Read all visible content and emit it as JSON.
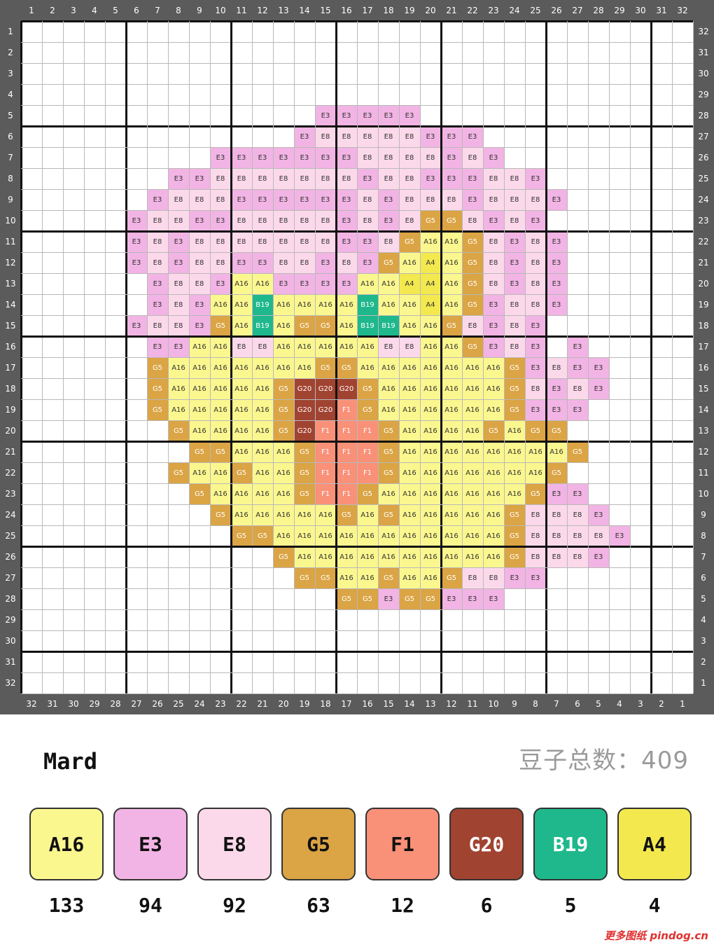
{
  "brand": "Mard",
  "total_label": "豆子总数：409",
  "site_label": "更多图纸 pindog.cn",
  "col_labels_top": [
    "1",
    "2",
    "3",
    "4",
    "5",
    "6",
    "7",
    "8",
    "9",
    "10",
    "11",
    "12",
    "13",
    "14",
    "15",
    "16",
    "17",
    "18",
    "19",
    "20",
    "21",
    "22",
    "23",
    "24",
    "25",
    "26",
    "27",
    "28",
    "29",
    "30",
    "31",
    "32"
  ],
  "col_labels_bottom": [
    "32",
    "31",
    "30",
    "29",
    "28",
    "27",
    "26",
    "25",
    "24",
    "23",
    "22",
    "21",
    "20",
    "19",
    "18",
    "17",
    "16",
    "15",
    "14",
    "13",
    "12",
    "11",
    "10",
    "9",
    "8",
    "7",
    "6",
    "5",
    "4",
    "3",
    "2",
    "1"
  ],
  "row_labels_left": [
    "1",
    "2",
    "3",
    "4",
    "5",
    "6",
    "7",
    "8",
    "9",
    "10",
    "11",
    "12",
    "13",
    "14",
    "15",
    "16",
    "17",
    "18",
    "19",
    "20",
    "21",
    "22",
    "23",
    "24",
    "25",
    "26",
    "27",
    "28",
    "29",
    "30",
    "31",
    "32"
  ],
  "row_labels_right": [
    "32",
    "31",
    "30",
    "29",
    "28",
    "27",
    "26",
    "25",
    "24",
    "23",
    "22",
    "21",
    "20",
    "19",
    "18",
    "17",
    "16",
    "15",
    "14",
    "13",
    "12",
    "11",
    "10",
    "9",
    "8",
    "7",
    "6",
    "5",
    "4",
    "3",
    "2",
    "1"
  ],
  "colors": {
    "A16": {
      "hex": "#fbf78f",
      "text": "#333333"
    },
    "E3": {
      "hex": "#f2b4e4",
      "text": "#333333"
    },
    "E8": {
      "hex": "#fcd9ea",
      "text": "#333333"
    },
    "G5": {
      "hex": "#dba444",
      "text": "#ffffff"
    },
    "F1": {
      "hex": "#f99078",
      "text": "#ffffff"
    },
    "G20": {
      "hex": "#a14331",
      "text": "#ffffff"
    },
    "B19": {
      "hex": "#1fb88c",
      "text": "#ffffff"
    },
    "A4": {
      "hex": "#f3e94e",
      "text": "#333333"
    }
  },
  "pattern": [
    {
      "row": 5,
      "start": 15,
      "cells": [
        "E3",
        "E3",
        "E3",
        "E3",
        "E3"
      ]
    },
    {
      "row": 6,
      "start": 14,
      "cells": [
        "E3",
        "E8",
        "E8",
        "E8",
        "E8",
        "E8",
        "E3",
        "E3",
        "E3"
      ]
    },
    {
      "row": 7,
      "start": 10,
      "cells": [
        "E3",
        "E3",
        "E3",
        "E3",
        "E3",
        "E3",
        "E3",
        "E8",
        "E8",
        "E8",
        "E8",
        "E3",
        "E8",
        "E3"
      ]
    },
    {
      "row": 8,
      "start": 8,
      "cells": [
        "E3",
        "E3",
        "E8",
        "E8",
        "E8",
        "E8",
        "E8",
        "E8",
        "E8",
        "E3",
        "E8",
        "E8",
        "E3",
        "E3",
        "E3",
        "E8",
        "E8",
        "E3"
      ]
    },
    {
      "row": 9,
      "start": 7,
      "cells": [
        "E3",
        "E8",
        "E8",
        "E8",
        "E3",
        "E3",
        "E3",
        "E3",
        "E3",
        "E3",
        "E8",
        "E3",
        "E8",
        "E8",
        "E8",
        "E3",
        "E8",
        "E8",
        "E8",
        "E3"
      ]
    },
    {
      "row": 10,
      "start": 6,
      "cells": [
        "E3",
        "E8",
        "E8",
        "E3",
        "E3",
        "E8",
        "E8",
        "E8",
        "E8",
        "E8",
        "E3",
        "E8",
        "E3",
        "E8",
        "G5",
        "G5",
        "E8",
        "E3",
        "E8",
        "E3"
      ]
    },
    {
      "row": 11,
      "start": 6,
      "cells": [
        "E3",
        "E8",
        "E3",
        "E8",
        "E8",
        "E8",
        "E8",
        "E8",
        "E8",
        "E8",
        "E3",
        "E3",
        "E8",
        "G5",
        "A16",
        "A16",
        "G5",
        "E8",
        "E3",
        "E8",
        "E3"
      ]
    },
    {
      "row": 12,
      "start": 6,
      "cells": [
        "E3",
        "E8",
        "E3",
        "E8",
        "E8",
        "E3",
        "E3",
        "E8",
        "E8",
        "E3",
        "E8",
        "E3",
        "G5",
        "A16",
        "A4",
        "A16",
        "G5",
        "E8",
        "E3",
        "E8",
        "E3"
      ]
    },
    {
      "row": 13,
      "start": 7,
      "cells": [
        "E3",
        "E8",
        "E8",
        "E3",
        "A16",
        "A16",
        "E3",
        "E3",
        "E3",
        "E3",
        "A16",
        "A16",
        "A4",
        "A4",
        "A16",
        "G5",
        "E8",
        "E3",
        "E8",
        "E3"
      ]
    },
    {
      "row": 14,
      "start": 7,
      "cells": [
        "E3",
        "E8",
        "E3",
        "A16",
        "A16",
        "B19",
        "A16",
        "A16",
        "A16",
        "A16",
        "B19",
        "A16",
        "A16",
        "A4",
        "A16",
        "G5",
        "E3",
        "E8",
        "E8",
        "E3"
      ]
    },
    {
      "row": 15,
      "start": 6,
      "cells": [
        "E3",
        "E8",
        "E8",
        "E3",
        "G5",
        "A16",
        "B19",
        "A16",
        "G5",
        "G5",
        "A16",
        "B19",
        "B19",
        "A16",
        "A16",
        "G5",
        "E8",
        "E3",
        "E8",
        "E3"
      ]
    },
    {
      "row": 16,
      "start": 7,
      "cells": [
        "E3",
        "E3",
        "A16",
        "A16",
        "E8",
        "E8",
        "A16",
        "A16",
        "A16",
        "A16",
        "A16",
        "E8",
        "E8",
        "A16",
        "A16",
        "G5",
        "E3",
        "E8",
        "E3",
        "",
        "E3"
      ]
    },
    {
      "row": 17,
      "start": 7,
      "cells": [
        "G5",
        "A16",
        "A16",
        "A16",
        "A16",
        "A16",
        "A16",
        "A16",
        "G5",
        "G5",
        "A16",
        "A16",
        "A16",
        "A16",
        "A16",
        "A16",
        "A16",
        "G5",
        "E3",
        "E8",
        "E3",
        "E3"
      ]
    },
    {
      "row": 18,
      "start": 7,
      "cells": [
        "G5",
        "A16",
        "A16",
        "A16",
        "A16",
        "A16",
        "G5",
        "G20",
        "G20",
        "G20",
        "G5",
        "A16",
        "A16",
        "A16",
        "A16",
        "A16",
        "A16",
        "G5",
        "E8",
        "E3",
        "E8",
        "E3"
      ]
    },
    {
      "row": 19,
      "start": 7,
      "cells": [
        "G5",
        "A16",
        "A16",
        "A16",
        "A16",
        "A16",
        "G5",
        "G20",
        "G20",
        "F1",
        "G5",
        "A16",
        "A16",
        "A16",
        "A16",
        "A16",
        "A16",
        "G5",
        "E3",
        "E3",
        "E3"
      ]
    },
    {
      "row": 20,
      "start": 8,
      "cells": [
        "G5",
        "A16",
        "A16",
        "A16",
        "A16",
        "G5",
        "G20",
        "F1",
        "F1",
        "F1",
        "G5",
        "A16",
        "A16",
        "A16",
        "A16",
        "G5",
        "A16",
        "G5",
        "G5"
      ]
    },
    {
      "row": 21,
      "start": 9,
      "cells": [
        "G5",
        "G5",
        "A16",
        "A16",
        "A16",
        "G5",
        "F1",
        "F1",
        "F1",
        "G5",
        "A16",
        "A16",
        "A16",
        "A16",
        "A16",
        "A16",
        "A16",
        "A16",
        "G5"
      ]
    },
    {
      "row": 22,
      "start": 8,
      "cells": [
        "G5",
        "A16",
        "A16",
        "G5",
        "A16",
        "A16",
        "G5",
        "F1",
        "F1",
        "F1",
        "G5",
        "A16",
        "A16",
        "A16",
        "A16",
        "A16",
        "A16",
        "A16",
        "G5"
      ]
    },
    {
      "row": 23,
      "start": 9,
      "cells": [
        "G5",
        "A16",
        "A16",
        "A16",
        "A16",
        "G5",
        "F1",
        "F1",
        "G5",
        "A16",
        "A16",
        "A16",
        "A16",
        "A16",
        "A16",
        "A16",
        "G5",
        "E3",
        "E3"
      ]
    },
    {
      "row": 24,
      "start": 10,
      "cells": [
        "G5",
        "A16",
        "A16",
        "A16",
        "A16",
        "A16",
        "G5",
        "A16",
        "G5",
        "A16",
        "A16",
        "A16",
        "A16",
        "A16",
        "G5",
        "E8",
        "E8",
        "E8",
        "E3"
      ]
    },
    {
      "row": 25,
      "start": 11,
      "cells": [
        "G5",
        "G5",
        "A16",
        "A16",
        "A16",
        "A16",
        "A16",
        "A16",
        "A16",
        "A16",
        "A16",
        "A16",
        "A16",
        "G5",
        "E8",
        "E8",
        "E8",
        "E8",
        "E3"
      ]
    },
    {
      "row": 26,
      "start": 13,
      "cells": [
        "G5",
        "A16",
        "A16",
        "A16",
        "A16",
        "A16",
        "A16",
        "A16",
        "A16",
        "A16",
        "A16",
        "G5",
        "E8",
        "E8",
        "E8",
        "E3"
      ]
    },
    {
      "row": 27,
      "start": 14,
      "cells": [
        "G5",
        "G5",
        "A16",
        "A16",
        "G5",
        "A16",
        "A16",
        "G5",
        "E8",
        "E8",
        "E3",
        "E3"
      ]
    },
    {
      "row": 28,
      "start": 16,
      "cells": [
        "G5",
        "G5",
        "E3",
        "G5",
        "G5",
        "E3",
        "E3",
        "E3"
      ]
    }
  ],
  "palette": [
    {
      "code": "A16",
      "count": "133"
    },
    {
      "code": "E3",
      "count": "94"
    },
    {
      "code": "E8",
      "count": "92"
    },
    {
      "code": "G5",
      "count": "63"
    },
    {
      "code": "F1",
      "count": "12"
    },
    {
      "code": "G20",
      "count": "6"
    },
    {
      "code": "B19",
      "count": "5"
    },
    {
      "code": "A4",
      "count": "4"
    }
  ]
}
